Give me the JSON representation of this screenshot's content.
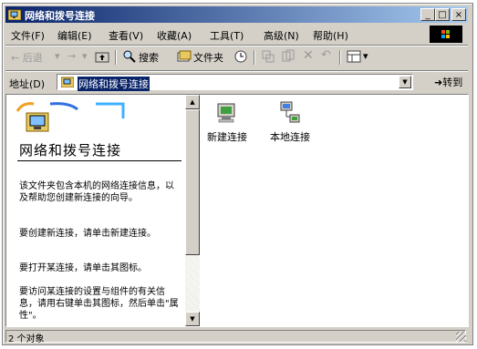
{
  "window": {
    "title": "网络和拨号连接",
    "buttons": {
      "minimize": "_",
      "maximize": "□",
      "close": "×"
    }
  },
  "menubar": {
    "items": [
      "文件(F)",
      "编辑(E)",
      "查看(V)",
      "收藏(A)",
      "工具(T)",
      "高级(N)",
      "帮助(H)"
    ]
  },
  "toolbar": {
    "back": "← 后退",
    "forward": "→",
    "search": "搜索",
    "folders": "文件夹"
  },
  "address": {
    "label": "地址(D)",
    "value": "网络和拨号连接",
    "go": "转到"
  },
  "leftpane": {
    "title": "网络和拨号连接",
    "paragraphs": [
      "该文件夹包含本机的网络连接信息，以及帮助您创建新连接的向导。",
      "要创建新连接，请单击新建连接。",
      "要打开某连接，请单击其图标。",
      "要访问某连接的设置与组件的有关信息，请用右键单击其图标，然后单击\"属性\"。"
    ]
  },
  "icons": [
    {
      "label": "新建连接",
      "icon": "new-connection-wizard-icon"
    },
    {
      "label": "本地连接",
      "icon": "local-area-connection-icon"
    }
  ],
  "status": {
    "text": "2 个对象"
  },
  "colors": {
    "titlebar_start": "#0a246a",
    "titlebar_end": "#a6caf0",
    "face": "#d4d0c8",
    "selection": "#0a246a"
  }
}
